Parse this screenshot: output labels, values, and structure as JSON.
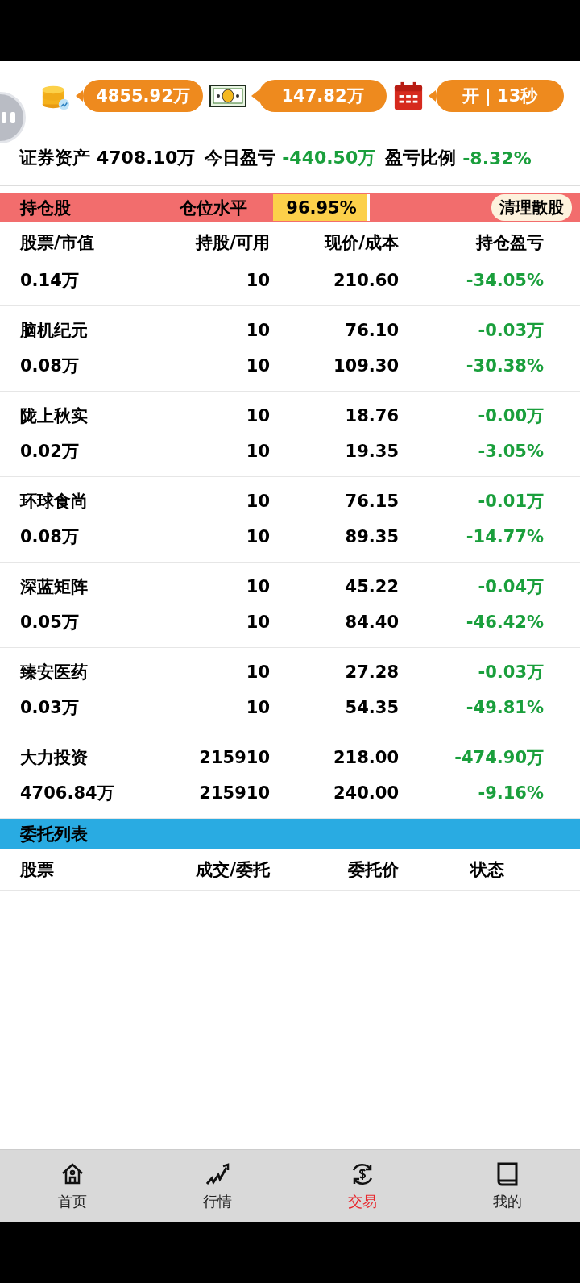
{
  "top_pills": [
    {
      "kind": "coins",
      "value": "4855.92万"
    },
    {
      "kind": "cash",
      "value": "147.82万"
    },
    {
      "kind": "calendar",
      "value": "开 | 13秒"
    }
  ],
  "summary": [
    {
      "label": "证券资产",
      "value": "4708.10万",
      "negative": false
    },
    {
      "label": "今日盈亏",
      "value": "-440.50万",
      "negative": true
    },
    {
      "label": "盈亏比例",
      "value": "-8.32%",
      "negative": true
    }
  ],
  "holdings_bar": {
    "title": "持仓股",
    "level_label": "仓位水平",
    "level_text": "96.95%",
    "level": 0.9695,
    "button": "清理散股"
  },
  "holdings_columns": [
    "股票/市值",
    "持股/可用",
    "现价/成本",
    "持仓盈亏"
  ],
  "holdings": [
    {
      "value": "0.14万",
      "available": "10",
      "cost": "210.60",
      "pnl_pct": "-34.05%"
    },
    {
      "name": "脑机纪元",
      "shares": "10",
      "price": "76.10",
      "pnl": "-0.03万",
      "value": "0.08万",
      "available": "10",
      "cost": "109.30",
      "pnl_pct": "-30.38%"
    },
    {
      "name": "陇上秋实",
      "shares": "10",
      "price": "18.76",
      "pnl": "-0.00万",
      "value": "0.02万",
      "available": "10",
      "cost": "19.35",
      "pnl_pct": "-3.05%"
    },
    {
      "name": "环球食尚",
      "shares": "10",
      "price": "76.15",
      "pnl": "-0.01万",
      "value": "0.08万",
      "available": "10",
      "cost": "89.35",
      "pnl_pct": "-14.77%"
    },
    {
      "name": "深蓝矩阵",
      "shares": "10",
      "price": "45.22",
      "pnl": "-0.04万",
      "value": "0.05万",
      "available": "10",
      "cost": "84.40",
      "pnl_pct": "-46.42%"
    },
    {
      "name": "臻安医药",
      "shares": "10",
      "price": "27.28",
      "pnl": "-0.03万",
      "value": "0.03万",
      "available": "10",
      "cost": "54.35",
      "pnl_pct": "-49.81%"
    },
    {
      "name": "大力投资",
      "shares": "215910",
      "price": "218.00",
      "pnl": "-474.90万",
      "value": "4706.84万",
      "available": "215910",
      "cost": "240.00",
      "pnl_pct": "-9.16%"
    }
  ],
  "orders_bar": {
    "title": "委托列表"
  },
  "orders_columns": [
    "股票",
    "成交/委托",
    "委托价",
    "状态"
  ],
  "nav": [
    {
      "kind": "home",
      "label": "首页",
      "selected": false
    },
    {
      "kind": "market",
      "label": "行情",
      "selected": false
    },
    {
      "kind": "trade",
      "label": "交易",
      "selected": true
    },
    {
      "kind": "me",
      "label": "我的",
      "selected": false
    }
  ]
}
